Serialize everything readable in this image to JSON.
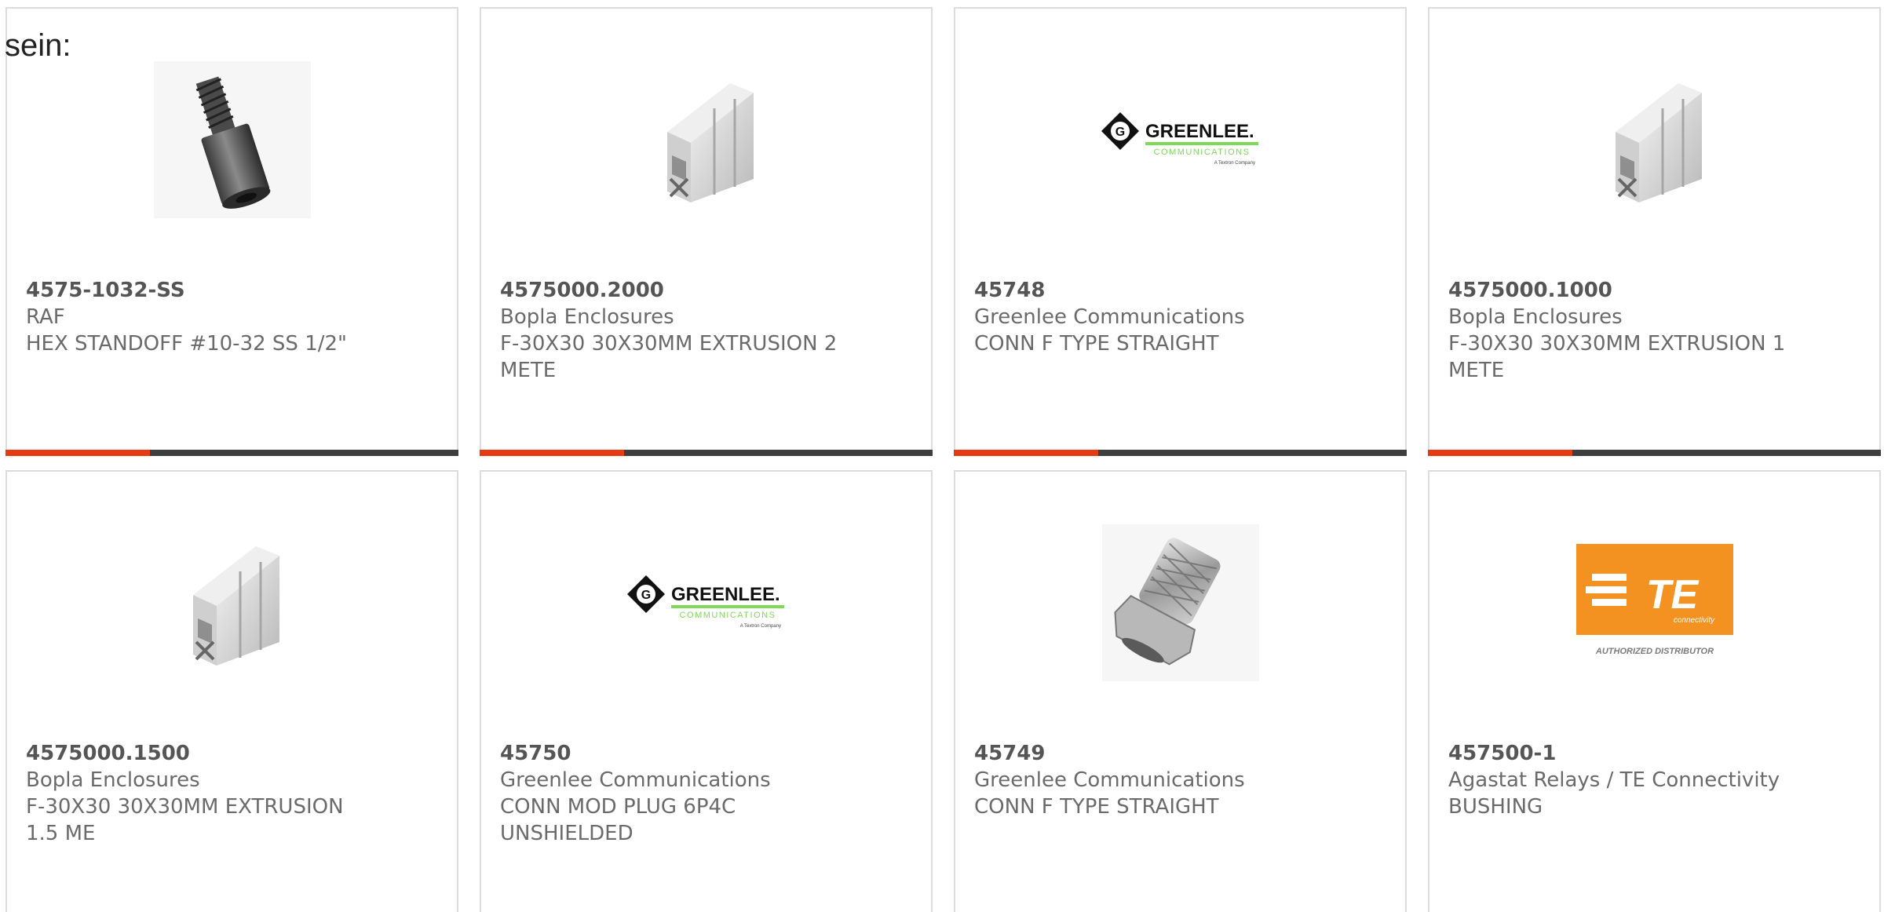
{
  "lead_text": "sein:",
  "products": [
    {
      "part": "4575-1032-SS",
      "manufacturer": "RAF",
      "description": "HEX STANDOFF #10-32 SS 1/2\"",
      "image": "hex-standoff-icon"
    },
    {
      "part": "4575000.2000",
      "manufacturer": "Bopla Enclosures",
      "description": "F-30X30 30X30MM EXTRUSION 2 METE",
      "image": "aluminum-extrusion-icon"
    },
    {
      "part": "45748",
      "manufacturer": "Greenlee Communications",
      "description": "CONN F TYPE STRAIGHT",
      "image": "greenlee-logo"
    },
    {
      "part": "4575000.1000",
      "manufacturer": "Bopla Enclosures",
      "description": "F-30X30 30X30MM EXTRUSION 1 METE",
      "image": "aluminum-extrusion-icon"
    },
    {
      "part": "4575000.1500",
      "manufacturer": "Bopla Enclosures",
      "description": "F-30X30 30X30MM EXTRUSION 1.5 ME",
      "image": "aluminum-extrusion-icon"
    },
    {
      "part": "45750",
      "manufacturer": "Greenlee Communications",
      "description": "CONN MOD PLUG 6P4C UNSHIELDED",
      "image": "greenlee-logo"
    },
    {
      "part": "45749",
      "manufacturer": "Greenlee Communications",
      "description": "CONN F TYPE STRAIGHT",
      "image": "f-connector-icon"
    },
    {
      "part": "457500-1",
      "manufacturer": "Agastat Relays / TE Connectivity",
      "description": "BUSHING",
      "image": "te-connectivity-logo"
    }
  ],
  "logos": {
    "greenlee_name": "GREENLEE.",
    "greenlee_sub": "COMMUNICATIONS",
    "greenlee_tag": "A Textron Company",
    "te_mark": "TE",
    "te_sub": "connectivity",
    "te_caption": "AUTHORIZED DISTRIBUTOR"
  },
  "colors": {
    "accent": "#e63b12",
    "bar": "#3e3e3e",
    "greenlee_green": "#7ed957",
    "te_orange": "#f39220"
  }
}
